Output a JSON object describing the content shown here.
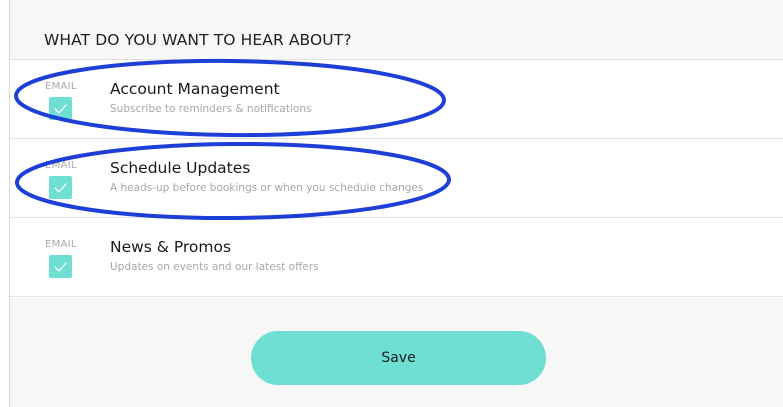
{
  "section": {
    "title": "WHAT DO YOU WANT TO HEAR ABOUT?"
  },
  "preferences": [
    {
      "channel": "EMAIL",
      "checked": true,
      "title": "Account Management",
      "subtitle": "Subscribe to reminders & notifications"
    },
    {
      "channel": "EMAIL",
      "checked": true,
      "title": "Schedule Updates",
      "subtitle": "A heads-up before bookings or when you schedule changes"
    },
    {
      "channel": "EMAIL",
      "checked": true,
      "title": "News & Promos",
      "subtitle": "Updates on events and our latest offers"
    }
  ],
  "actions": {
    "save_label": "Save"
  },
  "colors": {
    "accent": "#6edfd2",
    "annotation": "#1d3fd6",
    "header_bg": "#f7f7f7"
  },
  "icons": {
    "checkbox_mark": "checkmark-icon"
  }
}
